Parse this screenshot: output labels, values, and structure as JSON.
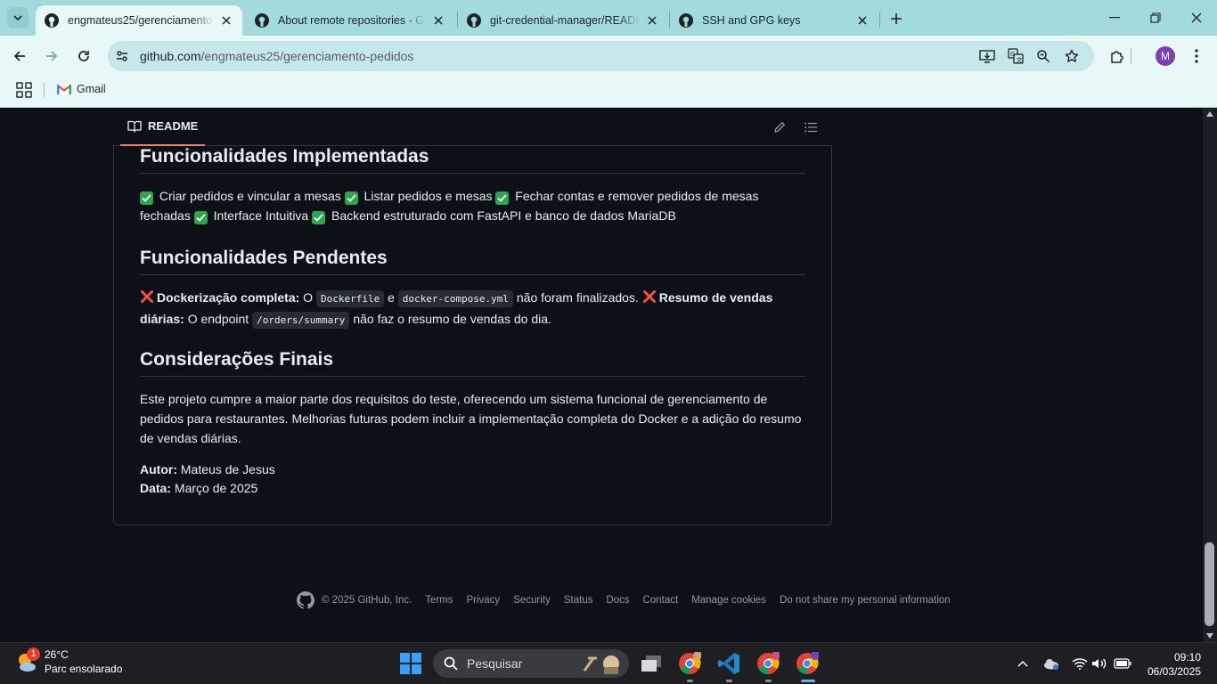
{
  "browser": {
    "tabs": [
      {
        "title": "engmateus25/gerenciamento-pedidos",
        "active": true
      },
      {
        "title": "About remote repositories - GitHub Docs",
        "active": false
      },
      {
        "title": "git-credential-manager/README.md",
        "active": false
      },
      {
        "title": "SSH and GPG keys",
        "active": false
      }
    ],
    "url_host": "github.com",
    "url_path": "/engmateus25/gerenciamento-pedidos",
    "profile_initial": "M",
    "bookmarks": [
      {
        "label": "Gmail"
      }
    ]
  },
  "readme": {
    "tab_label": "README",
    "sections": {
      "implemented": {
        "heading": "Funcionalidades Implementadas",
        "items": [
          "Criar pedidos e vincular a mesas",
          "Listar pedidos e mesas",
          "Fechar contas e remover pedidos de mesas fechadas",
          "Interface Intuitiva",
          "Backend estruturado com FastAPI e banco de dados MariaDB"
        ]
      },
      "pending": {
        "heading": "Funcionalidades Pendentes",
        "item1_title": "Dockerização completa:",
        "item1_text_a": " O ",
        "item1_code_a": "Dockerfile",
        "item1_text_b": " e ",
        "item1_code_b": "docker-compose.yml",
        "item1_text_c": " não foram finalizados. ",
        "item2_title": "Resumo de vendas diárias:",
        "item2_text_a": " O endpoint ",
        "item2_code": "/orders/summary",
        "item2_text_b": " não faz o resumo de vendas do dia."
      },
      "final": {
        "heading": "Considerações Finais",
        "paragraph": "Este projeto cumpre a maior parte dos requisitos do teste, oferecendo um sistema funcional de gerenciamento de pedidos para restaurantes. Melhorias futuras podem incluir a implementação completa do Docker e a adição do resumo de vendas diárias.",
        "author_label": "Autor:",
        "author_value": " Mateus de Jesus",
        "date_label": "Data:",
        "date_value": " Março de 2025"
      }
    }
  },
  "footer": {
    "copyright": "© 2025 GitHub, Inc.",
    "links": [
      "Terms",
      "Privacy",
      "Security",
      "Status",
      "Docs",
      "Contact",
      "Manage cookies",
      "Do not share my personal information"
    ]
  },
  "taskbar": {
    "weather_badge": "1",
    "temperature": "26°C",
    "weather_desc": "Parc ensolarado",
    "search_label": "Pesquisar",
    "time": "09:10",
    "date": "06/03/2025"
  },
  "colors": {
    "accent_tab": "#f78166",
    "check_green": "#2da44e",
    "cross_red": "#f85149"
  }
}
